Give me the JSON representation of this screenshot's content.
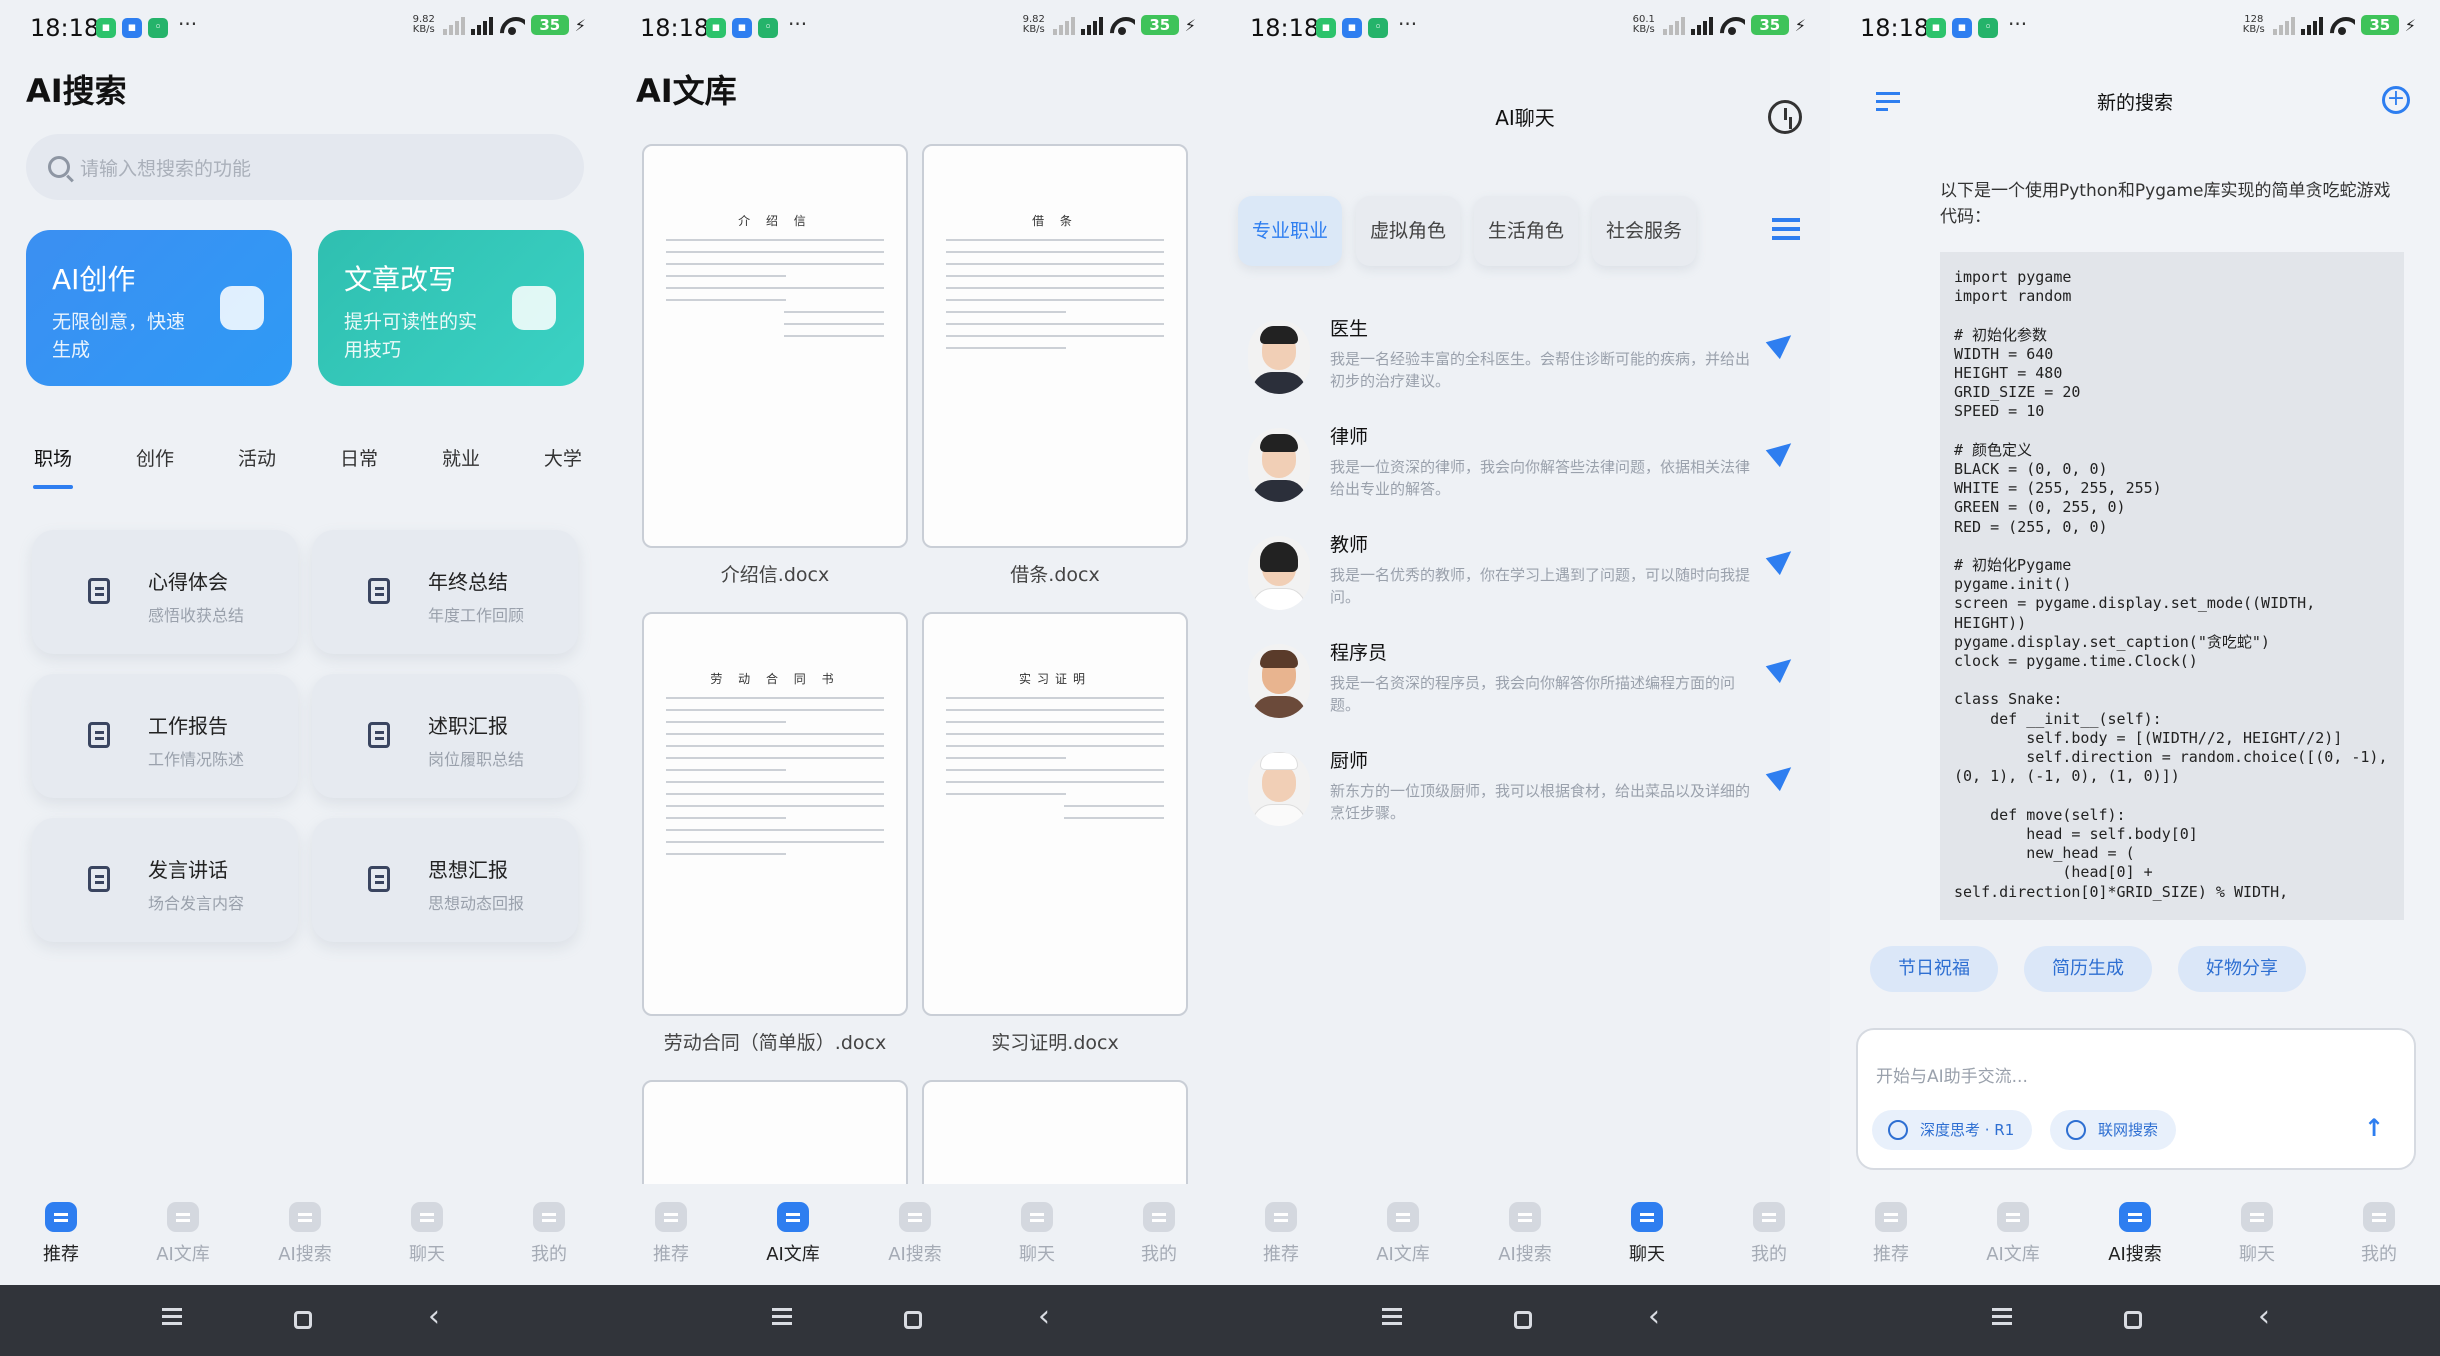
{
  "status": {
    "time": "18:18",
    "battery": "35",
    "speeds": [
      "9.82 KB/s",
      "9.82 KB/s",
      "60.1 KB/s",
      "128 KB/s"
    ]
  },
  "s1": {
    "title": "AI搜索",
    "search_placeholder": "请输入想搜索的功能",
    "cards": [
      {
        "title": "AI创作",
        "desc": "无限创意，快速生成"
      },
      {
        "title": "文章改写",
        "desc": "提升可读性的实用技巧"
      }
    ],
    "cats": [
      "职场",
      "创作",
      "活动",
      "日常",
      "就业",
      "大学"
    ],
    "tiles": [
      {
        "name": "心得体会",
        "sub": "感悟收获总结"
      },
      {
        "name": "年终总结",
        "sub": "年度工作回顾"
      },
      {
        "name": "工作报告",
        "sub": "工作情况陈述"
      },
      {
        "name": "述职汇报",
        "sub": "岗位履职总结"
      },
      {
        "name": "发言讲话",
        "sub": "场合发言内容"
      },
      {
        "name": "思想汇报",
        "sub": "思想动态回报"
      }
    ]
  },
  "s2": {
    "title": "AI文库",
    "docs": [
      {
        "name": "介绍信.docx",
        "heading": "介 绍 信"
      },
      {
        "name": "借条.docx",
        "heading": "借 条"
      },
      {
        "name": "劳动合同（简单版）.docx",
        "heading": "劳 动 合 同 书"
      },
      {
        "name": "实习证明.docx",
        "heading": "实习证明"
      }
    ]
  },
  "s3": {
    "title": "AI聊天",
    "tabs": [
      "专业职业",
      "虚拟角色",
      "生活角色",
      "社会服务"
    ],
    "roles": [
      {
        "name": "医生",
        "desc": "我是一名经验丰富的全科医生。会帮住诊断可能的疾病，并给出初步的治疗建议。"
      },
      {
        "name": "律师",
        "desc": "我是一位资深的律师，我会向你解答些法律问题，依据相关法律给出专业的解答。"
      },
      {
        "name": "教师",
        "desc": "我是一名优秀的教师，你在学习上遇到了问题，可以随时向我提问。"
      },
      {
        "name": "程序员",
        "desc": "我是一名资深的程序员，我会向你解答你所描述编程方面的问题。"
      },
      {
        "name": "厨师",
        "desc": "新东方的一位顶级厨师，我可以根据食材，给出菜品以及详细的烹饪步骤。"
      }
    ]
  },
  "s4": {
    "title": "新的搜索",
    "intro": "以下是一个使用Python和Pygame库实现的简单贪吃蛇游戏代码：",
    "code": "import pygame\nimport random\n\n# 初始化参数\nWIDTH = 640\nHEIGHT = 480\nGRID_SIZE = 20\nSPEED = 10\n\n# 颜色定义\nBLACK = (0, 0, 0)\nWHITE = (255, 255, 255)\nGREEN = (0, 255, 0)\nRED = (255, 0, 0)\n\n# 初始化Pygame\npygame.init()\nscreen = pygame.display.set_mode((WIDTH,\nHEIGHT))\npygame.display.set_caption(\"贪吃蛇\")\nclock = pygame.time.Clock()\n\nclass Snake:\n    def __init__(self):\n        self.body = [(WIDTH//2, HEIGHT//2)]\n        self.direction = random.choice([(0, -1),\n(0, 1), (-1, 0), (1, 0)])\n\n    def move(self):\n        head = self.body[0]\n        new_head = (\n            (head[0] +\nself.direction[0]*GRID_SIZE) % WIDTH,",
    "chips": [
      "节日祝福",
      "简历生成",
      "好物分享"
    ],
    "input_placeholder": "开始与AI助手交流...",
    "opt_think": "深度思考 · R1",
    "opt_web": "联网搜索"
  },
  "nav": [
    "推荐",
    "AI文库",
    "AI搜索",
    "聊天",
    "我的"
  ],
  "colors": {
    "accent": "#2e7ef0",
    "card1": "#2f8cf0",
    "card2": "#2fc5b4"
  }
}
